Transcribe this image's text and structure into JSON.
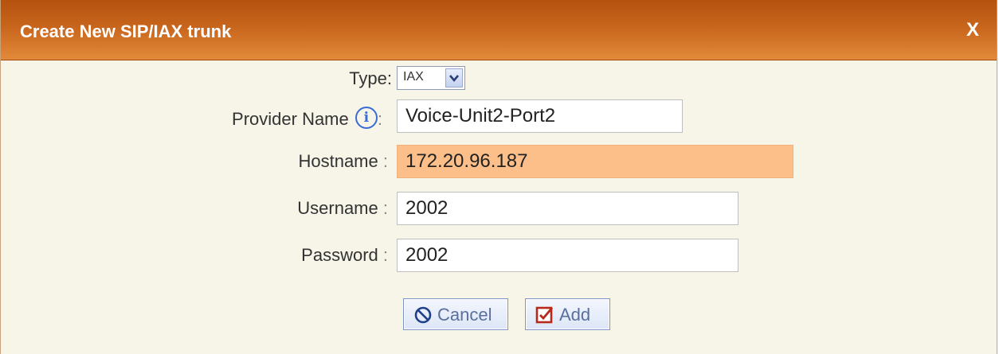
{
  "dialog": {
    "title": "Create New SIP/IAX trunk",
    "close_label": "X"
  },
  "form": {
    "type": {
      "label": "Type:",
      "selected": "IAX"
    },
    "provider_name": {
      "label": "Provider Name",
      "info_glyph": "i",
      "colon": ":",
      "value": "Voice-Unit2-Port2"
    },
    "hostname": {
      "label": "Hostname",
      "colon": ":",
      "value": "172.20.96.187"
    },
    "username": {
      "label": "Username",
      "colon": ":",
      "value": "2002"
    },
    "password": {
      "label": "Password",
      "colon": ":",
      "value": "2002"
    }
  },
  "buttons": {
    "cancel_label": "Cancel",
    "add_label": "Add"
  },
  "colors": {
    "titlebar": "#c8651c",
    "highlight_field": "#fdbf8a",
    "dialog_bg": "#f7f4e8"
  }
}
